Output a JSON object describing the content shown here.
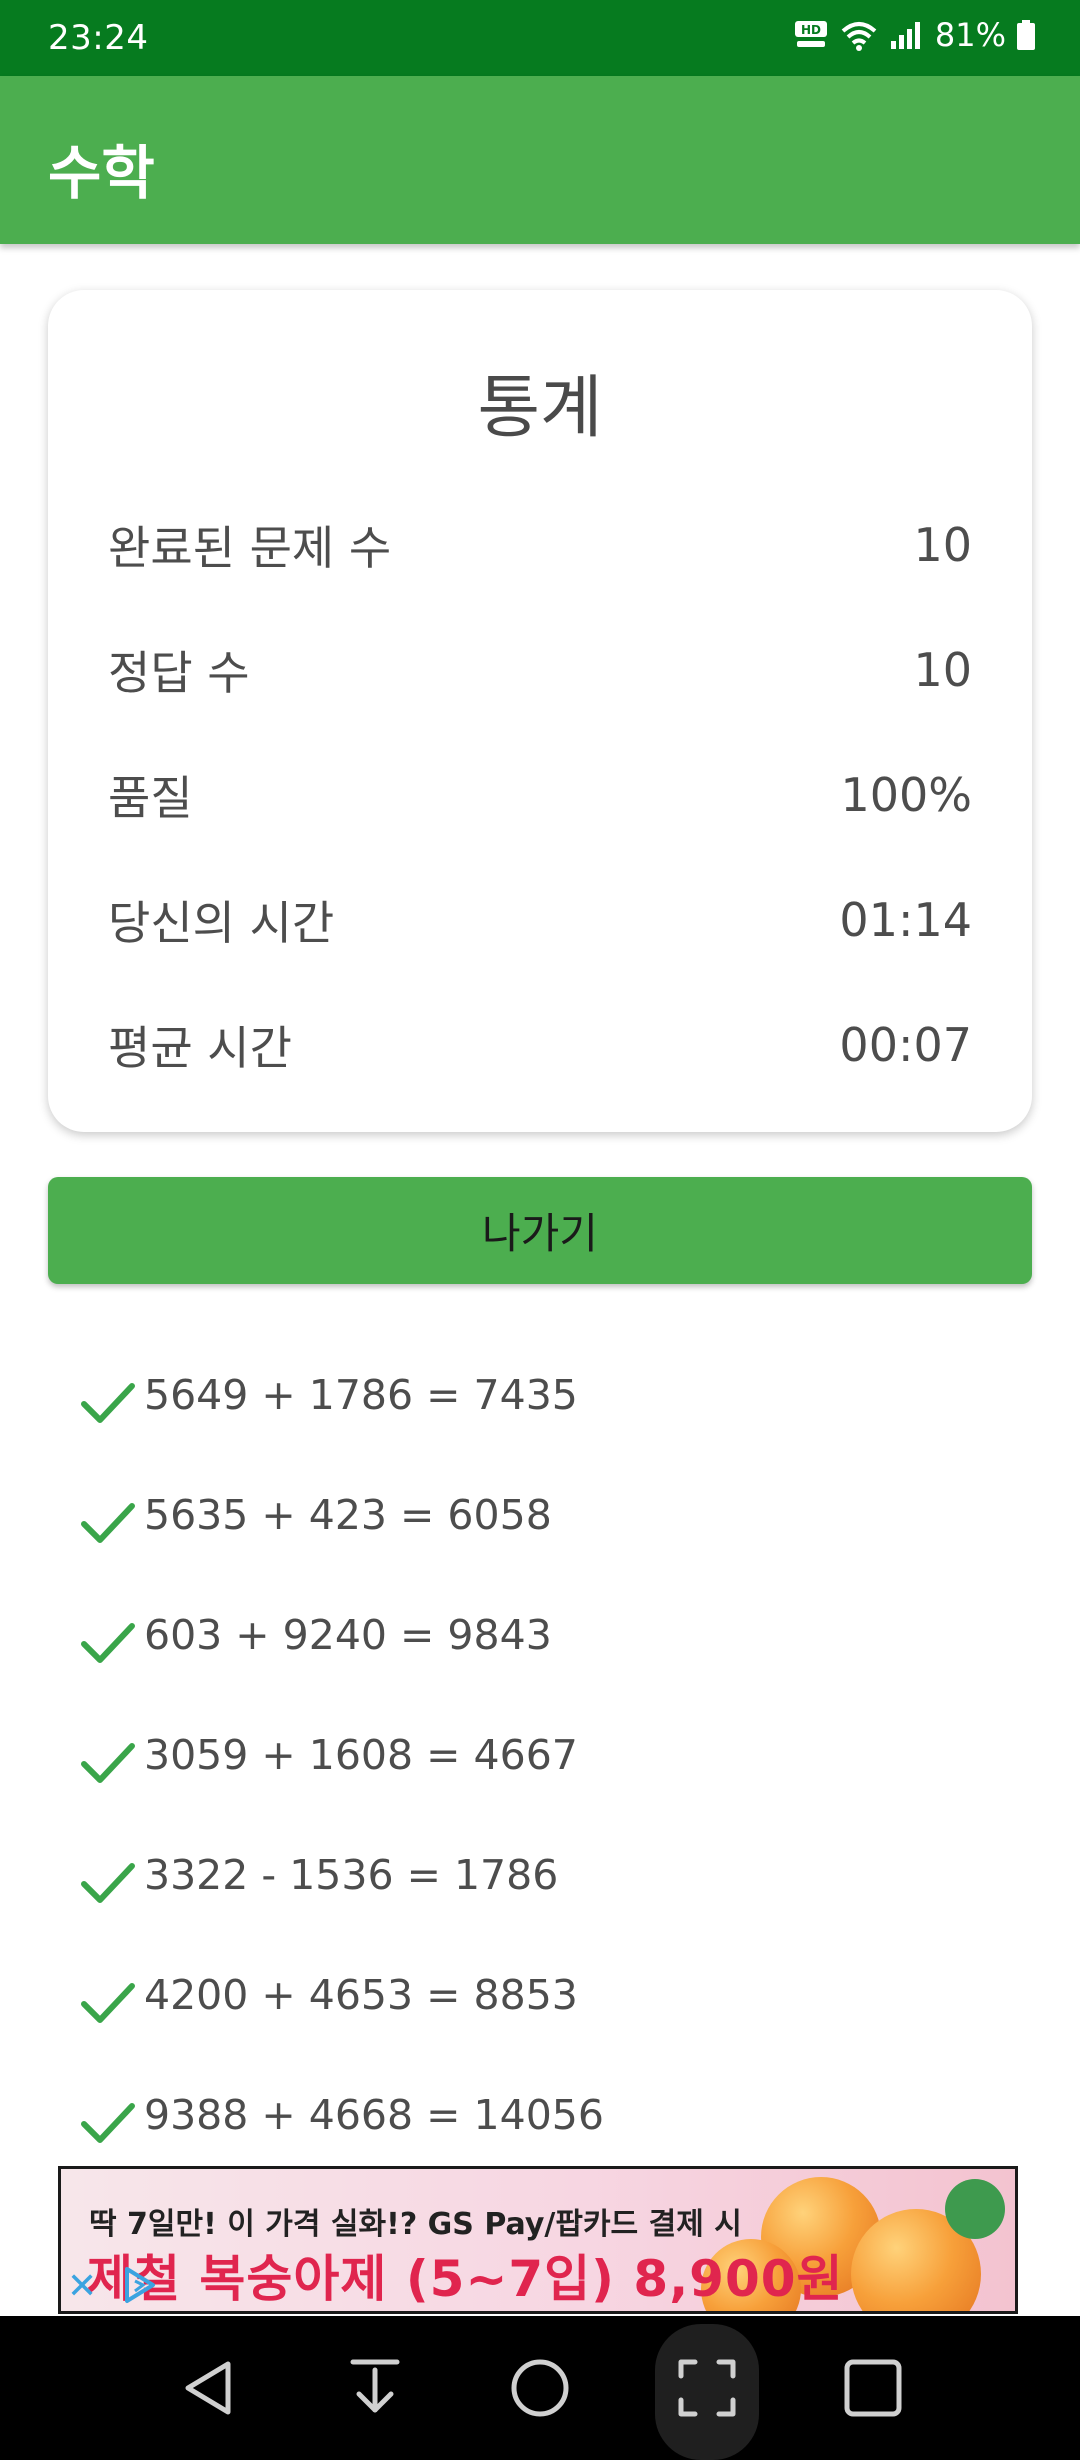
{
  "status_bar": {
    "time": "23:24",
    "hd_voice": "HD",
    "battery": "81%"
  },
  "app_bar": {
    "title": "수학"
  },
  "stats": {
    "title": "통계",
    "rows": [
      {
        "label": "완료된 문제 수",
        "value": "10"
      },
      {
        "label": "정답 수",
        "value": "10"
      },
      {
        "label": "품질",
        "value": "100%"
      },
      {
        "label": "당신의 시간",
        "value": "01:14"
      },
      {
        "label": "평균 시간",
        "value": "00:07"
      }
    ]
  },
  "exit_button": {
    "label": "나가기"
  },
  "problems": [
    {
      "text": "5649 + 1786 = 7435",
      "status": "correct"
    },
    {
      "text": "5635 + 423 = 6058",
      "status": "correct"
    },
    {
      "text": "603 + 9240 = 9843",
      "status": "correct"
    },
    {
      "text": "3059 + 1608 = 4667",
      "status": "correct"
    },
    {
      "text": "3322 - 1536 = 1786",
      "status": "correct"
    },
    {
      "text": "4200 + 4653 = 8853",
      "status": "correct"
    },
    {
      "text": "9388 + 4668 = 14056",
      "status": "correct"
    }
  ],
  "ad": {
    "line1": "딱 7일만! 이 가격 실화!? GS Pay/팝카드 결제 시",
    "line2": "제철 복숭아제 (5~7입) 8,900원",
    "close_icon": "close-icon",
    "choices_icon": "ad-choices-icon"
  },
  "colors": {
    "status_bar": "#067b1f",
    "app_bar": "#4cae4f",
    "accent_green": "#4cae4f",
    "check_green": "#3aa54a"
  },
  "nav": {
    "icons": [
      "back-icon",
      "download-icon",
      "home-icon",
      "capture-icon",
      "recents-icon"
    ]
  }
}
